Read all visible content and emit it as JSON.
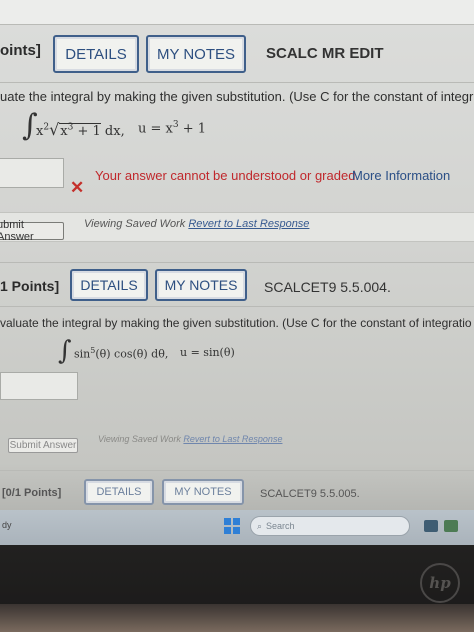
{
  "problem1": {
    "points_label": "oints]",
    "details_label": "DETAILS",
    "notes_label": "MY NOTES",
    "code": "SCALC MR EDIT",
    "prompt": "uate the integral by making the given substitution. (Use C for the constant of integr",
    "integral_symbol": "∫",
    "integrand_x": "x",
    "integrand_x_power": "2",
    "radical_sign": "√",
    "radicand_x": "x",
    "radicand_power": "3",
    "radicand_tail": " + 1",
    "dx": " dx,",
    "sub_u": "u = x",
    "sub_power": "3",
    "sub_tail": " + 1",
    "error_icon": "x-icon",
    "error_text": "Your answer cannot be understood or graded.",
    "more_info": "More Information",
    "submit_label": "ubmit Answer",
    "viewing_text": "Viewing Saved Work",
    "revert_link": "Revert to Last Response"
  },
  "problem2": {
    "points_label": "1 Points]",
    "details_label": "DETAILS",
    "notes_label": "MY NOTES",
    "code": "SCALCET9 5.5.004.",
    "prompt": "valuate the integral by making the given substitution. (Use C for the constant of integratio",
    "integral_symbol": "∫",
    "integrand_sin": "sin",
    "integrand_power": "5",
    "integrand_rest": "(θ) cos(θ) dθ,",
    "substitution": "u = sin(θ)",
    "submit_label": "Submit Answer",
    "viewing_text": "Viewing Saved Work",
    "revert_link": "Revert to Last Response"
  },
  "problem3": {
    "points_label": "[0/1 Points]",
    "details_label": "DETAILS",
    "notes_label": "MY NOTES",
    "code": "SCALCET9 5.5.005."
  },
  "taskbar": {
    "weather_fragment": "dy",
    "search_placeholder": "Search"
  },
  "laptop": {
    "brand": "hp"
  },
  "colors": {
    "accent_blue": "#2d4f80",
    "error_red": "#c0282c",
    "background": "#d6d7d4"
  }
}
